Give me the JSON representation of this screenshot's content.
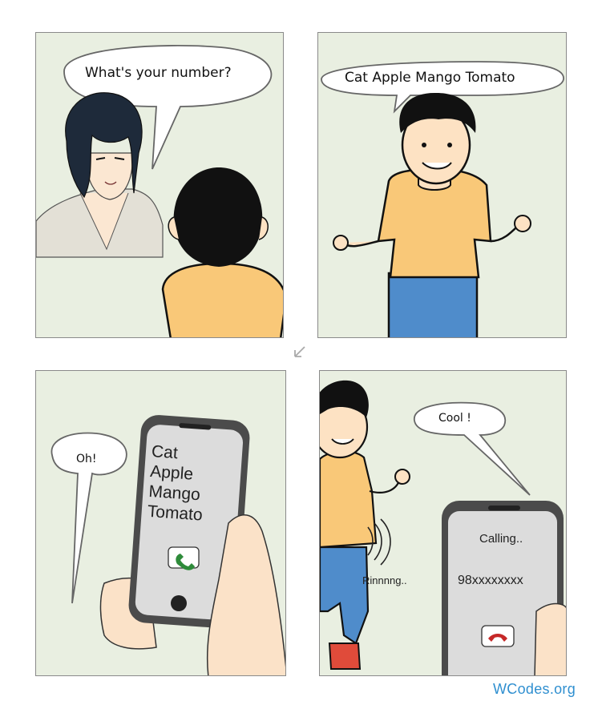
{
  "panels": {
    "p1": {
      "speech": "What's your number?"
    },
    "p2": {
      "speech": "Cat Apple Mango Tomato"
    },
    "p3": {
      "speech": "Oh!",
      "phone_lines": [
        "Cat",
        "Apple",
        "Mango",
        "Tomato"
      ]
    },
    "p4": {
      "speech": "Cool !",
      "calling": "Calling..",
      "number": "98xxxxxxxx",
      "ring_sound": "Rinnnng.."
    }
  },
  "watermark": "WCodes.org",
  "colors": {
    "panel_bg": "#e9efe1",
    "shirt": "#f9c878",
    "jeans": "#4f8ccb",
    "skin": "#fde2c3",
    "hair": "#111111",
    "accept_green": "#2e8b3a",
    "decline_red": "#c62828",
    "watermark": "#2f8fd0"
  },
  "icons": [
    "answer-call-icon",
    "end-call-icon",
    "read-order-arrow-icon",
    "ringing-waves-icon"
  ]
}
